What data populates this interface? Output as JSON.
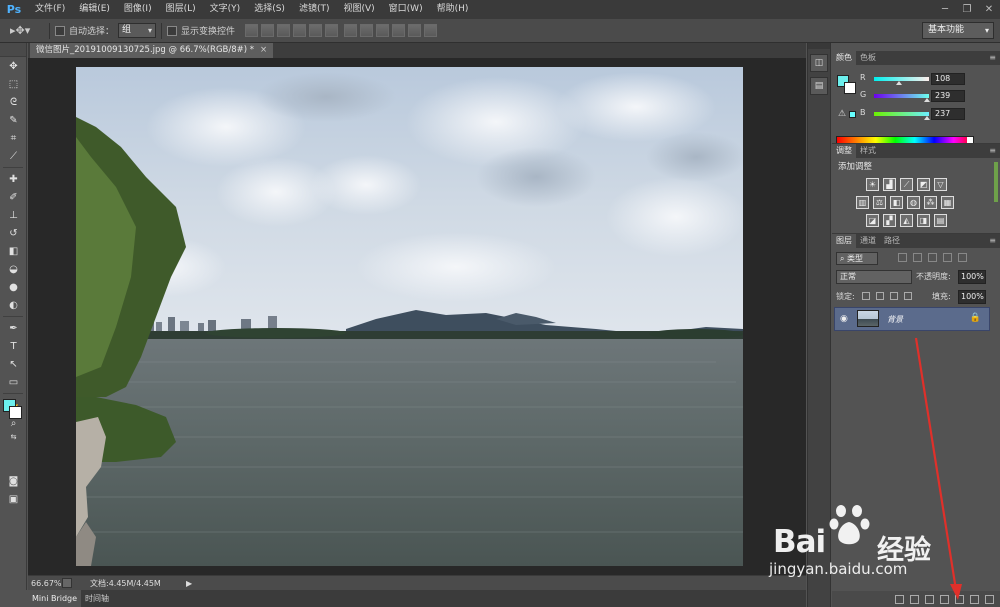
{
  "app": {
    "logo": "Ps"
  },
  "menu": [
    "文件(F)",
    "编辑(E)",
    "图像(I)",
    "图层(L)",
    "文字(Y)",
    "选择(S)",
    "滤镜(T)",
    "视图(V)",
    "窗口(W)",
    "帮助(H)"
  ],
  "options_bar": {
    "auto_select_label": "自动选择：",
    "auto_select_value": "组",
    "transform_label": "显示变换控件",
    "workspace": "基本功能"
  },
  "document": {
    "tab_title": "微信图片_20191009130725.jpg @ 66.7%(RGB/8#) *",
    "close": "×"
  },
  "status": {
    "zoom": "66.67%",
    "doc_info": "文档:4.45M/4.45M"
  },
  "bottom_tabs": [
    "Mini Bridge",
    "时间轴"
  ],
  "color_panel": {
    "tabs": [
      "颜色",
      "色板"
    ],
    "r_label": "R",
    "r_value": "108",
    "g_label": "G",
    "g_value": "239",
    "b_label": "B",
    "b_value": "237",
    "fg_color": "#6cefed"
  },
  "adjust_panel": {
    "tabs": [
      "调整",
      "样式"
    ],
    "title": "添加调整"
  },
  "layers_panel": {
    "tabs": [
      "图层",
      "通道",
      "路径"
    ],
    "filter": "类型",
    "blend_mode": "正常",
    "opacity_label": "不透明度:",
    "opacity_value": "100%",
    "lock_label": "锁定:",
    "fill_label": "填充:",
    "fill_value": "100%",
    "layer_name": "背景"
  },
  "watermark": {
    "brand": "Bai",
    "brand_cn": "经验",
    "url": "jingyan.baidu.com"
  }
}
